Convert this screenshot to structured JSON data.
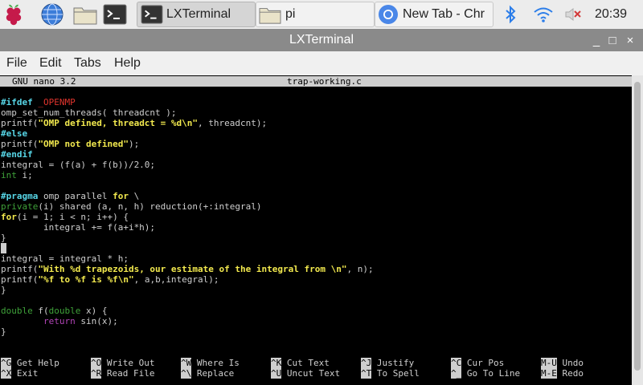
{
  "taskbar": {
    "tasks": [
      {
        "label": "LXTerminal"
      },
      {
        "label": "pi"
      },
      {
        "label": "New Tab - Chr"
      }
    ],
    "clock": "20:39"
  },
  "window": {
    "title": "LXTerminal",
    "controls": {
      "minimize": "_",
      "maximize": "□",
      "close": "×"
    }
  },
  "menu": {
    "items": [
      "File",
      "Edit",
      "Tabs",
      "Help"
    ]
  },
  "nano": {
    "version": "GNU nano 3.2",
    "filename": "trap-working.c"
  },
  "code": {
    "l1": {
      "a": "#ifdef",
      "b": " _OPENMP"
    },
    "l2": "omp_set_num_threads( threadcnt );",
    "l3": {
      "a": "printf(",
      "b": "\"OMP defined, threadct = %d\\n\"",
      "c": ", threadcnt);"
    },
    "l4": "#else",
    "l5": {
      "a": "printf(",
      "b": "\"OMP not defined\"",
      "c": ");"
    },
    "l6": "#endif",
    "l7": "integral = (f(a) + f(b))/2.0;",
    "l8": {
      "a": "int",
      "b": " i;"
    },
    "l9": {
      "a": "#pragma",
      "b": " omp parallel ",
      "c": "for",
      "d": " \\"
    },
    "l10": {
      "a": "private",
      "b": "(i) shared (a, n, h) reduction(+:integral)"
    },
    "l11": {
      "a": "for",
      "b": "(i = 1; i < n; i++) {"
    },
    "l12": "        integral += f(a+i*h);",
    "l13": "}",
    "l14": " ",
    "l15": "integral = integral * h;",
    "l16": {
      "a": "printf(",
      "b": "\"With %d trapezoids, our estimate of the integral from \\n\"",
      "c": ", n);"
    },
    "l17": {
      "a": "printf(",
      "b": "\"%f to %f is %f\\n\"",
      "c": ", a,b,integral);"
    },
    "l18": "}",
    "l19": {
      "a": "double",
      "b": " f(",
      "c": "double",
      "d": " x) {"
    },
    "l20": {
      "a": "        ",
      "b": "return",
      "c": " sin(x);"
    },
    "l21": "}"
  },
  "shortcuts": [
    {
      "key": "^G",
      "label": "Get Help"
    },
    {
      "key": "^O",
      "label": "Write Out"
    },
    {
      "key": "^W",
      "label": "Where Is"
    },
    {
      "key": "^K",
      "label": "Cut Text"
    },
    {
      "key": "^J",
      "label": "Justify"
    },
    {
      "key": "^C",
      "label": "Cur Pos"
    },
    {
      "key": "M-U",
      "label": "Undo"
    },
    {
      "key": "^X",
      "label": "Exit"
    },
    {
      "key": "^R",
      "label": "Read File"
    },
    {
      "key": "^\\",
      "label": "Replace"
    },
    {
      "key": "^U",
      "label": "Uncut Text"
    },
    {
      "key": "^T",
      "label": "To Spell"
    },
    {
      "key": "^_",
      "label": "Go To Line"
    },
    {
      "key": "M-E",
      "label": "Redo"
    }
  ],
  "colors": {
    "taskbar_bg": "#ececec",
    "titlebar_bg": "#8a8a8a",
    "keyword_cyan": "#57d6e7",
    "string_yellow": "#f2e94e",
    "type_green": "#3fa23a",
    "return_purple": "#b144b6",
    "macro_red": "#e0342d"
  }
}
